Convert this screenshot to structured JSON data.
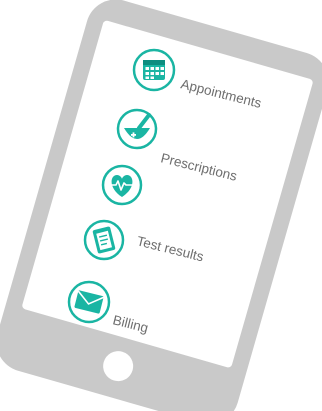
{
  "illustration": "tilted smartphone with patient portal menu",
  "colors": {
    "phone_body": "#c9c9c9",
    "phone_screen": "#ffffff",
    "home_button": "#ffffff",
    "accent": "#1ab5a3",
    "accent_dark": "#0e8d80",
    "label": "#6e6e6e"
  },
  "menu": {
    "items": [
      {
        "label": "Appointments",
        "icon": "calendar-icon"
      },
      {
        "label": "Prescriptions",
        "icon": "mortar-pestle-icon"
      },
      {
        "label": "",
        "icon": "heart-pulse-icon"
      },
      {
        "label": "Test results",
        "icon": "clipboard-icon"
      },
      {
        "label": "Billing",
        "icon": "envelope-icon"
      }
    ]
  }
}
